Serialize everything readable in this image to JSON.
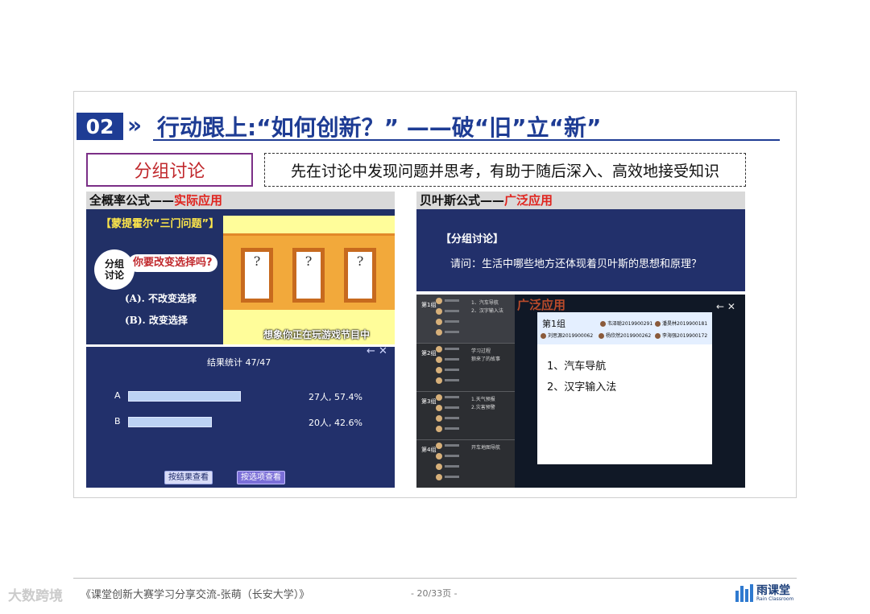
{
  "header": {
    "number": "02",
    "arrows": "»",
    "title": "行动跟上:“如何创新？” ——破“旧”立“新”"
  },
  "labels": {
    "group_discussion": "分组讨论",
    "description": "先在讨论中发现问题并思考，有助于随后深入、高效地接受知识"
  },
  "panel_left_top": {
    "title_black": "全概率公式——",
    "title_red": "实际应用",
    "problem_title": "【蒙提霍尔“三门问题”】",
    "bubble": "分组\n讨论",
    "question": "你要改变选择吗?",
    "option_a": "(A). 不改变选择",
    "option_b": "(B). 改变选择",
    "door_mark": "?",
    "caption": "想象你正在玩游戏节目中"
  },
  "panel_left_bottom": {
    "result_title": "结果统计 47/47",
    "controls": "← ✕",
    "bars": [
      {
        "label": "A",
        "count": "27人, 57.4%",
        "fraction": 0.574
      },
      {
        "label": "B",
        "count": "20人, 42.6%",
        "fraction": 0.426
      }
    ],
    "btn_by_result": "按结果查看",
    "btn_by_option": "按选项查看"
  },
  "panel_right_top": {
    "title_black": "贝叶斯公式——",
    "title_red": "广泛应用",
    "section": "【分组讨论】",
    "question": "请问：生活中哪些地方还体现着贝叶斯的思想和原理？"
  },
  "panel_right_bottom": {
    "background_title": "广泛应用",
    "controls": "← ✕",
    "groups": [
      {
        "name": "第1组",
        "items": "1、汽车导航\n2、汉字输入法"
      },
      {
        "name": "第2组",
        "items": "学习过程\n狼来了的故事"
      },
      {
        "name": "第3组",
        "items": "1.天气预报\n2.灾害预警"
      },
      {
        "name": "第4组",
        "items": "开车地图导航"
      }
    ],
    "window": {
      "group": "第1组",
      "members": [
        "韦泽聪2019900291",
        "潘昊林2019900181",
        "刘思源2019900062",
        "杨欣然2019900262",
        "李海强2019900172"
      ],
      "answers": [
        "1、汽车导航",
        "2、汉字输入法"
      ]
    }
  },
  "footer": {
    "text": "《课堂创新大赛学习分享交流-张萌（长安大学）》",
    "page": "- 20/33页 -",
    "watermark": "大数跨境",
    "logo_name": "雨课堂",
    "logo_sub": "Rain Classroom"
  }
}
